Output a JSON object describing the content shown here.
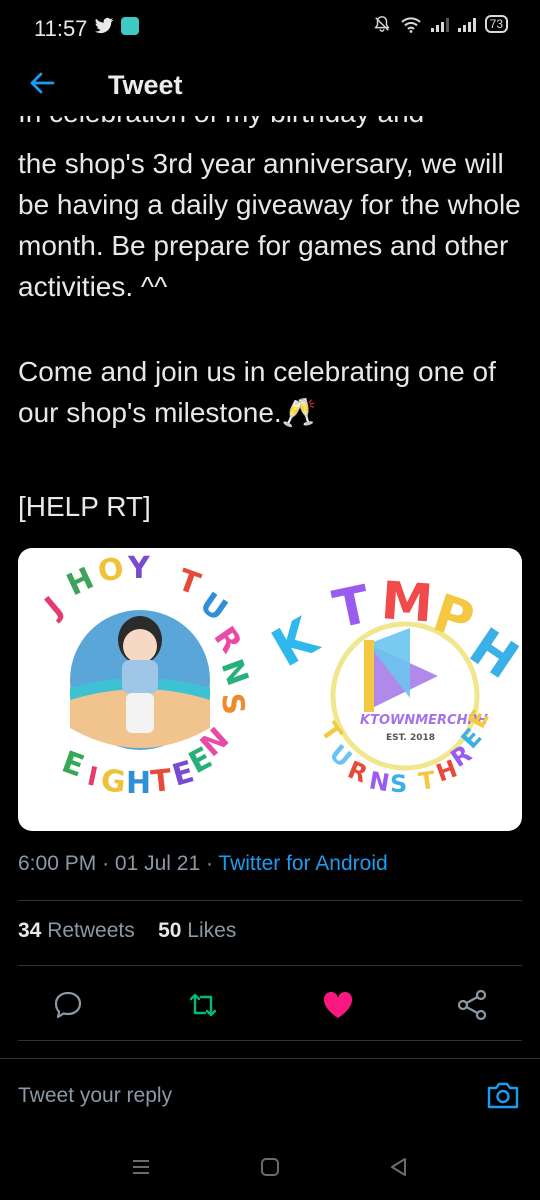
{
  "status_bar": {
    "time": "11:57",
    "battery": "73"
  },
  "header": {
    "title": "Tweet"
  },
  "tweet": {
    "partial_line": "In celebration of my birthday and",
    "paragraph1": "the shop's 3rd year anniversary, we will be having a daily giveaway for the whole month. Be prepare for games and other activities. ^^",
    "paragraph2": "Come and join us in celebrating one of our shop's milestone.🥂",
    "paragraph3": "[HELP RT]"
  },
  "image": {
    "left_ring_text": "JHOY TURNS EIGHTEEN",
    "right_big_letters": "KTMPH",
    "right_brand": "KTOWNMERCHPH",
    "right_est": "EST. 2018",
    "right_ring_text": "TURNS THREE"
  },
  "meta": {
    "time": "6:00 PM",
    "date": "01 Jul 21",
    "source": "Twitter for Android"
  },
  "stats": {
    "retweets_count": "34",
    "retweets_label": "Retweets",
    "likes_count": "50",
    "likes_label": "Likes"
  },
  "reply": {
    "placeholder": "Tweet your reply"
  },
  "colors": {
    "accent": "#1d9bf0",
    "like": "#f91880",
    "retweet": "#00ba7c"
  }
}
